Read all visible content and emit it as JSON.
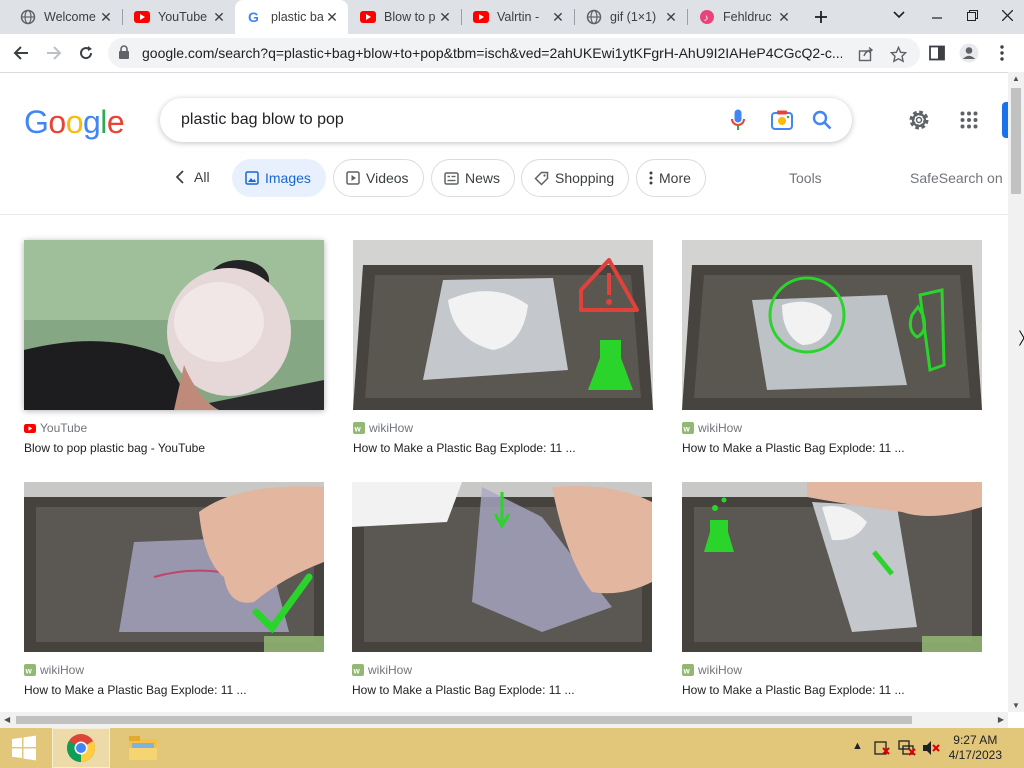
{
  "browser": {
    "tabs": [
      {
        "title": "Welcome",
        "favicon": "globe-icon",
        "active": false
      },
      {
        "title": "YouTube",
        "favicon": "youtube-icon",
        "active": false
      },
      {
        "title": "plastic ba",
        "favicon": "google-icon",
        "active": true
      },
      {
        "title": "Blow to p",
        "favicon": "youtube-icon",
        "active": false
      },
      {
        "title": "Valrtin -",
        "favicon": "youtube-icon",
        "active": false
      },
      {
        "title": "gif (1×1)",
        "favicon": "globe-icon",
        "active": false
      },
      {
        "title": "Fehldruc",
        "favicon": "music-icon",
        "active": false
      }
    ],
    "url": "google.com/search?q=plastic+bag+blow+to+pop&tbm=isch&ved=2ahUKEwi1ytKFgrH-AhU9I2IAHeP4CGcQ2-c..."
  },
  "google": {
    "logo_letters": [
      "G",
      "o",
      "o",
      "g",
      "l",
      "e"
    ],
    "logo_colors": [
      "#4285F4",
      "#EA4335",
      "#FBBC05",
      "#4285F4",
      "#34A853",
      "#EA4335"
    ],
    "search_query": "plastic bag blow to pop",
    "chips": {
      "all": "All",
      "images": "Images",
      "videos": "Videos",
      "news": "News",
      "shopping": "Shopping",
      "more": "More"
    },
    "tools": "Tools",
    "safesearch": "SafeSearch on"
  },
  "results": [
    {
      "source": "YouTube",
      "source_icon": "youtube-icon",
      "title": "Blow to pop plastic bag - YouTube"
    },
    {
      "source": "wikiHow",
      "source_icon": "wikihow-icon",
      "title": "How to Make a Plastic Bag Explode: 11 ..."
    },
    {
      "source": "wikiHow",
      "source_icon": "wikihow-icon",
      "title": "How to Make a Plastic Bag Explode: 11 ..."
    },
    {
      "source": "wikiHow",
      "source_icon": "wikihow-icon",
      "title": "How to Make a Plastic Bag Explode: 11 ..."
    },
    {
      "source": "wikiHow",
      "source_icon": "wikihow-icon",
      "title": "How to Make a Plastic Bag Explode: 11 ..."
    },
    {
      "source": "wikiHow",
      "source_icon": "wikihow-icon",
      "title": "How to Make a Plastic Bag Explode: 11 ..."
    }
  ],
  "taskbar": {
    "time": "9:27 AM",
    "date": "4/17/2023"
  },
  "colors": {
    "accent": "#1a73e8",
    "chip_active_bg": "#e8f0fe",
    "taskbar": "#e2c77b",
    "youtube_red": "#ff0000",
    "wikihow_green": "#93b874"
  }
}
